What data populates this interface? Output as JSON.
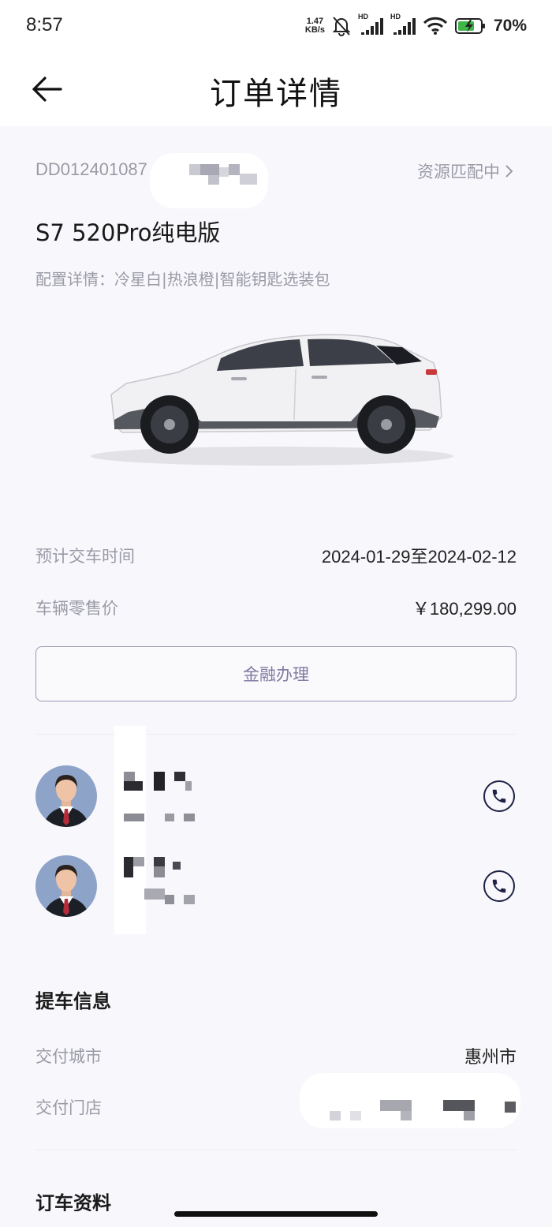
{
  "status_bar": {
    "time": "8:57",
    "net_speed_value": "1.47",
    "net_speed_unit": "KB/s",
    "signal_label": "HD",
    "battery_level": "70%",
    "icons": [
      "mute-bell-icon",
      "signal-icon",
      "signal-icon",
      "wifi-icon",
      "battery-charging-icon"
    ]
  },
  "navbar": {
    "title": "订单详情",
    "back_icon": "arrow-left-icon"
  },
  "order": {
    "number_visible": "DD012401087",
    "status": "资源匹配中",
    "status_icon": "chevron-right-icon",
    "model": "S7 520Pro纯电版",
    "config_label": "配置详情：",
    "config_value": "冷星白|热浪橙|智能钥匙选装包",
    "car_image": "white-suv-side-view"
  },
  "details": {
    "delivery_time_label": "预计交车时间",
    "delivery_time_value": "2024-01-29至2024-02-12",
    "price_label": "车辆零售价",
    "price_value": "￥180,299.00"
  },
  "finance_button": "金融办理",
  "contacts_icons": {
    "avatar": "advisor-avatar-icon",
    "phone": "phone-icon"
  },
  "pickup": {
    "title": "提车信息",
    "city_label": "交付城市",
    "city_value": "惠州市",
    "store_label": "交付门店"
  },
  "order_docs": {
    "title": "订车资料"
  },
  "colors": {
    "background": "#f8f8fc",
    "muted_text": "#9a9aa6",
    "accent_purple": "#807ba2",
    "phone_icon_navy": "#1e2245"
  }
}
